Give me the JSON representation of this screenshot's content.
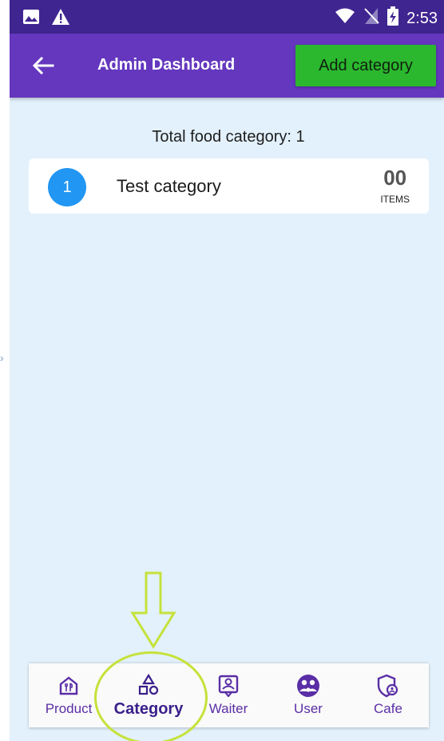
{
  "status_bar": {
    "time": "2:53"
  },
  "app_bar": {
    "title": "Admin Dashboard",
    "add_button_label": "Add category"
  },
  "summary": {
    "total_text": "Total food category: 1"
  },
  "categories": [
    {
      "index": "1",
      "name": "Test category",
      "count": "00",
      "unit": "ITEMS"
    }
  ],
  "bottom_nav": {
    "items": [
      {
        "label": "Product",
        "icon": "product-icon"
      },
      {
        "label": "Category",
        "icon": "category-shapes-icon",
        "active": true
      },
      {
        "label": "Waiter",
        "icon": "waiter-badge-icon"
      },
      {
        "label": "User",
        "icon": "user-group-icon"
      },
      {
        "label": "Cafe",
        "icon": "cafe-shield-icon"
      }
    ]
  },
  "colors": {
    "status_bar": "#3f2590",
    "app_bar": "#6437be",
    "add_button": "#2bb82e",
    "background": "#e3f1fc",
    "avatar": "#2196f3",
    "nav_accent": "#5a2ea6",
    "annotation": "#c5e23a"
  }
}
